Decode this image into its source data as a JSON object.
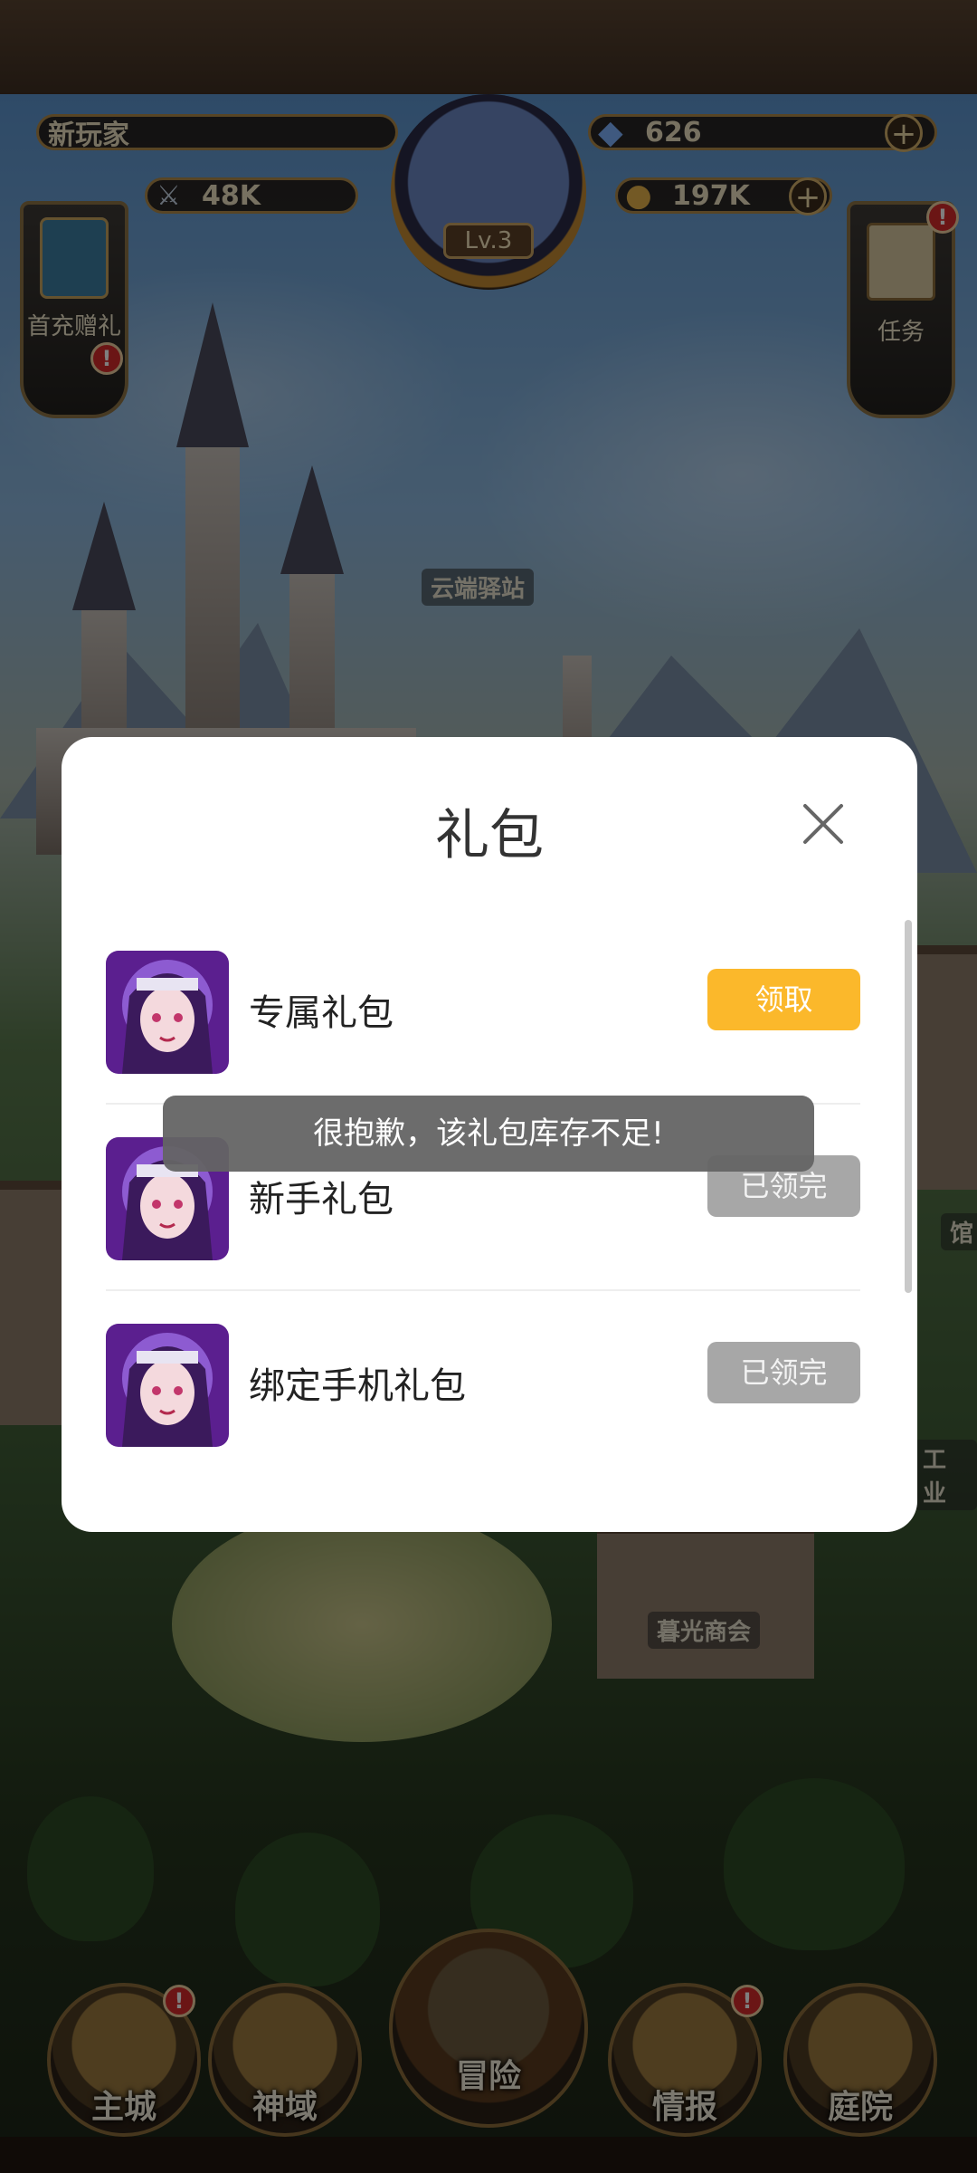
{
  "hud": {
    "player_name": "新玩家",
    "power": "48K",
    "diamonds": "626",
    "gold": "197K",
    "level": "Lv.3",
    "first_recharge_label": "首充赠礼",
    "quest_label": "任务",
    "badge": "!"
  },
  "map_labels": {
    "airship": "云端驿站",
    "merchant": "暮光商会",
    "right_hall": "馆",
    "industry": "工业"
  },
  "bottom_nav": {
    "items": [
      "主城",
      "神域",
      "冒险",
      "情报",
      "庭院"
    ]
  },
  "dialog": {
    "title": "礼包",
    "gifts": [
      {
        "name": "专属礼包",
        "button": "领取",
        "status": "claimable"
      },
      {
        "name": "新手礼包",
        "button": "已领完",
        "status": "depleted"
      },
      {
        "name": "绑定手机礼包",
        "button": "已领完",
        "status": "depleted"
      }
    ]
  },
  "toast": {
    "message": "很抱歉，该礼包库存不足!"
  },
  "colors": {
    "claim_button": "#fbb82b",
    "done_button": "#a7a7a7",
    "toast_bg": "#646464",
    "dialog_bg": "#ffffff"
  }
}
